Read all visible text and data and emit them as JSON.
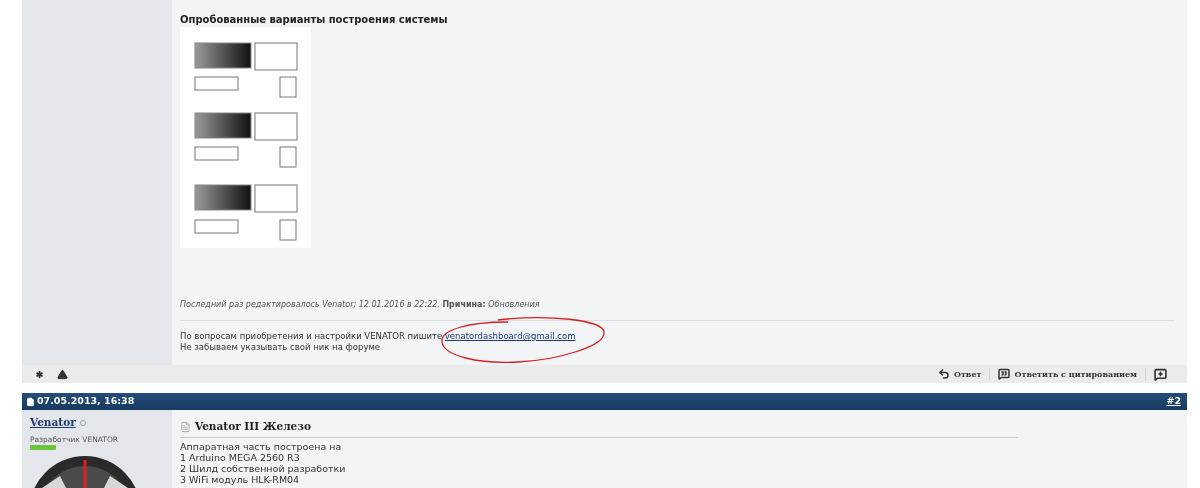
{
  "post1": {
    "heading": "Опробованные варианты построения системы",
    "edit_note": "*Последний раз редактировалось Venator; 12.01.2016 в 22:22.* **Причина:** *Обновления*",
    "signature": {
      "text": "По вопросам приобретения и настройки VENATOR пишите",
      "link": "venatordashboard@gmail.com",
      "line2": "Не забываем указывать свой ник на форуме"
    }
  },
  "post_actions": [
    {
      "kind": "reply",
      "label": "Ответ"
    },
    {
      "kind": "quote",
      "label": "Ответить с цитированием"
    },
    {
      "kind": "multiquote"
    }
  ],
  "post2": {
    "date": "07.05.2013, 16:38",
    "number": "#2",
    "author": "Venator",
    "online": false,
    "user_title": "Разработчик VENATOR",
    "title": "Venator III Железо",
    "body_lines": [
      "Аппаратная часть построена на",
      "1 Arduino MEGA 2560 R3",
      "2 Шилд собственной разработки",
      "3 WiFi модуль HLK-RM04"
    ]
  }
}
